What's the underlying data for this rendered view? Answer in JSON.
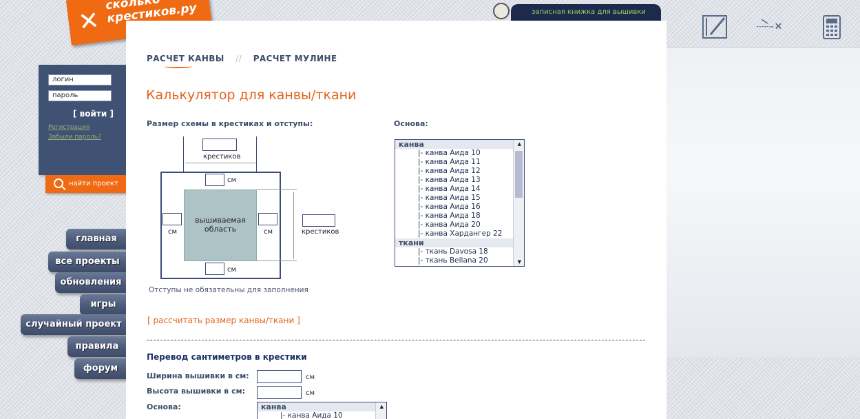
{
  "logo": {
    "line1": "сколько-",
    "line2": "крестиков.ру"
  },
  "header": {
    "notebook_label": "записная книжка для вышивки"
  },
  "login": {
    "login_placeholder": "логин",
    "password_placeholder": "пароль",
    "submit_label": "[ войти ]",
    "register_link": "Регистрация",
    "forgot_link": "Забыли пароль?"
  },
  "find_button": "найти проект",
  "nav": [
    "главная",
    "все проекты",
    "обновления",
    "игры",
    "случайный проект",
    "правила",
    "форум"
  ],
  "tabs": {
    "canvas": "РАСЧЕТ КАНВЫ",
    "separator": "//",
    "floss": "РАСЧЕТ МУЛИНЕ"
  },
  "page_title": "Калькулятор для канвы/ткани",
  "diagram": {
    "section_label": "Размер схемы в крестиках и отступы:",
    "crosses": "крестиков",
    "cm": "см",
    "area": "вышиваемая область",
    "note": "Отступы не обязательны для заполнения"
  },
  "base": {
    "label": "Основа:",
    "groups": [
      {
        "name": "канва",
        "items": [
          "|- канва Аида 10",
          "|- канва Аида 11",
          "|- канва Аида 12",
          "|- канва Аида 13",
          "|- канва Аида 14",
          "|- канва Аида 15",
          "|- канва Аида 16",
          "|- канва Аида 18",
          "|- канва Аида 20",
          "|- канва Хардангер 22"
        ]
      },
      {
        "name": "ткани",
        "items": [
          "|- ткань Davosa 18",
          "|- ткань Bellana 20"
        ]
      }
    ]
  },
  "calc_link": "[ рассчитать размер канвы/ткани ]",
  "conversion": {
    "title": "Перевод сантиметров в крестики",
    "width_label": "Ширина вышивки в см:",
    "height_label": "Высота вышивки в см:",
    "base_label": "Основа:",
    "unit": "см",
    "list_group": "канва",
    "list_first": "|- канва Аида 10"
  }
}
